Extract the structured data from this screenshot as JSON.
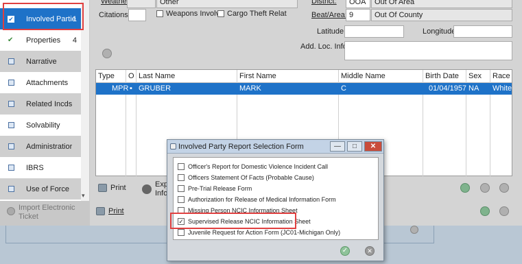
{
  "sidebar": {
    "items": [
      {
        "label": "Involved Partie",
        "count": "1",
        "icon": "check-icon",
        "active": true
      },
      {
        "label": "Properties",
        "count": "4",
        "icon": "check-icon"
      },
      {
        "label": "Narrative",
        "count": "",
        "icon": "doc-icon"
      },
      {
        "label": "Attachments",
        "count": "",
        "icon": "doc-icon"
      },
      {
        "label": "Related Incds",
        "count": "",
        "icon": "doc-icon"
      },
      {
        "label": "Solvability",
        "count": "",
        "icon": "doc-icon"
      },
      {
        "label": "Administratior",
        "count": "",
        "icon": "doc-icon"
      },
      {
        "label": "IBRS",
        "count": "",
        "icon": "doc-icon"
      },
      {
        "label": "Use of Force",
        "count": "",
        "icon": "doc-icon"
      }
    ],
    "footer": {
      "line1": "Import Electronic",
      "line2": "Ticket"
    }
  },
  "form": {
    "weather_label": "Weather:",
    "weather_value": "Other",
    "district_label": "District:",
    "district_code": "OOA",
    "district_value": "Out Of Area",
    "citations_label": "Citations:",
    "weapons_label": "Weapons Involve",
    "cargo_label": "Cargo Theft Relat",
    "beat_label": "Beat/Area:",
    "beat_code": "9",
    "beat_value": "Out Of County",
    "latitude_label": "Latitude:",
    "longitude_label": "Longitude",
    "addloc_label": "Add. Loc. Info:"
  },
  "grid": {
    "columns": [
      "Type",
      "O",
      "Last Name",
      "First Name",
      "Middle Name",
      "Birth Date",
      "Sex",
      "Race"
    ],
    "rows": [
      {
        "type": "MPR",
        "o": "▪",
        "last": "GRUBER",
        "first": "MARK",
        "middle": "C",
        "birth": "01/04/1957",
        "sex": "NA",
        "race": "White"
      }
    ]
  },
  "actions": {
    "print1": "Print",
    "export1": "Expo",
    "export2": "Infor",
    "print2": "Print"
  },
  "dialog": {
    "title": "Involved Party Report Selection Form",
    "items": [
      {
        "label": "Officer's Report for Domestic Violence Incident Call",
        "checked": false
      },
      {
        "label": "Officers Statement Of Facts (Probable Cause)",
        "checked": false
      },
      {
        "label": "Pre-Trial Release Form",
        "checked": false
      },
      {
        "label": "Authorization for Release of Medical Information Form",
        "checked": false
      },
      {
        "label": "Missing Person NCIC Information Sheet",
        "checked": false
      },
      {
        "label": "Supervised Release NCIC Information Sheet",
        "checked": true
      },
      {
        "label": "Juvenile Request for Action Form (JC01-Michigan Only)",
        "checked": false
      }
    ],
    "min_glyph": "—",
    "max_glyph": "□",
    "close_glyph": "✕",
    "ok_glyph": "✓",
    "cancel_glyph": "✕"
  },
  "colors": {
    "accent": "#1e72c8",
    "highlight": "#e04040"
  }
}
